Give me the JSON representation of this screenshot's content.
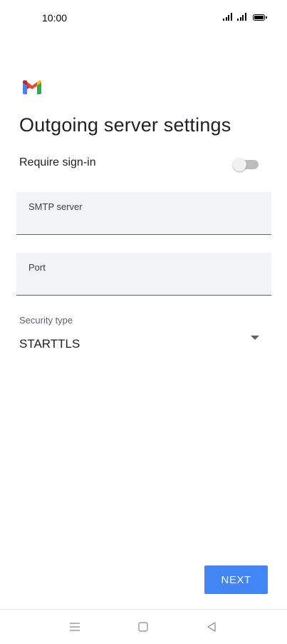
{
  "status_bar": {
    "time": "10:00",
    "icons": [
      "signal-icon",
      "signal-icon",
      "battery-icon"
    ]
  },
  "app": {
    "logo": "gmail-logo",
    "brand_colors": {
      "red": "#EA4335",
      "blue": "#4285F4",
      "green": "#34A853",
      "yellow": "#FBBC04"
    }
  },
  "page": {
    "title": "Outgoing server settings"
  },
  "require_signin": {
    "label": "Require sign-in",
    "enabled": false
  },
  "smtp_server": {
    "label": "SMTP server",
    "value": ""
  },
  "port": {
    "label": "Port",
    "value": ""
  },
  "security_type": {
    "label": "Security type",
    "selected": "STARTTLS"
  },
  "actions": {
    "next_label": "NEXT",
    "accent": "#4285F4"
  },
  "nav_bar": {
    "icons": [
      "menu-icon",
      "home-icon",
      "back-icon"
    ]
  }
}
